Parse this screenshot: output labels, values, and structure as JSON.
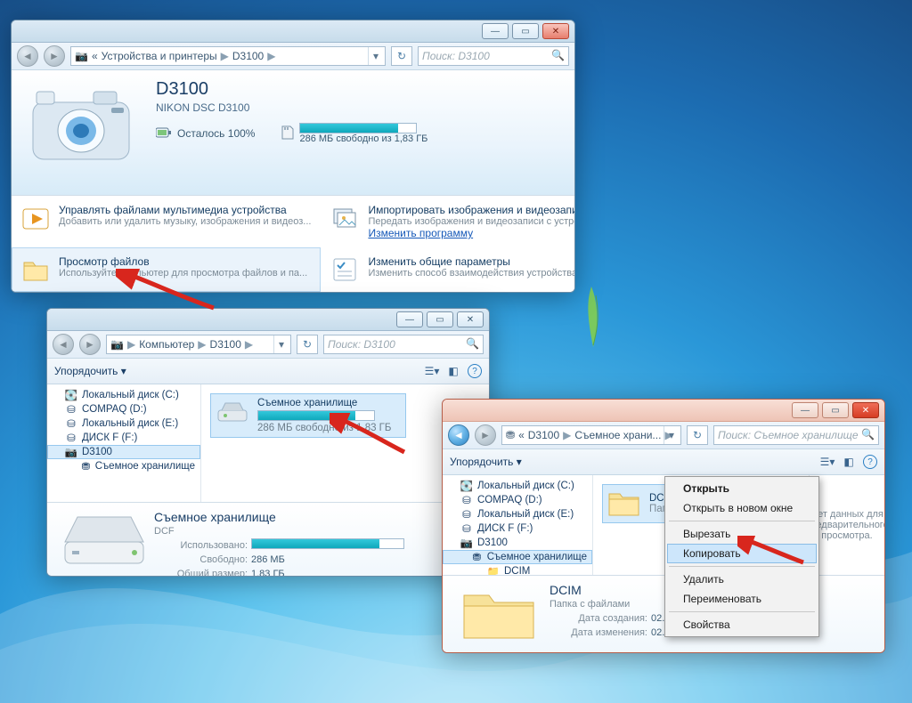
{
  "window1": {
    "breadcrumb_root": "Устройства и принтеры",
    "breadcrumb_item": "D3100",
    "search_placeholder": "Поиск: D3100",
    "device_title": "D3100",
    "device_subtitle": "NIKON DSC D3100",
    "battery_label": "Осталось 100%",
    "storage_label": "286 МБ свободно из 1,83 ГБ",
    "storage_fill_pct": 84,
    "tasks": {
      "manage": {
        "title": "Управлять файлами мультимедиа устройства",
        "desc": "Добавить или удалить музыку, изображения и видеоз..."
      },
      "import": {
        "title": "Импортировать изображения и видеозаписи",
        "desc": "Передать изображения и видеозаписи с устройства н...",
        "link": "Изменить программу"
      },
      "view": {
        "title": "Просмотр файлов",
        "desc": "Используйте компьютер для просмотра файлов и па..."
      },
      "settings": {
        "title": "Изменить общие параметры",
        "desc": "Изменить способ взаимодействия устройства с Wind..."
      }
    }
  },
  "window2": {
    "breadcrumb_root": "Компьютер",
    "breadcrumb_item": "D3100",
    "search_placeholder": "Поиск: D3100",
    "organize_label": "Упорядочить ▾",
    "tree": {
      "cdisk": "Локальный диск (C:)",
      "compaq": "COMPAQ (D:)",
      "edisk": "Локальный диск (E:)",
      "fdisk": "ДИСК F (F:)",
      "d3100": "D3100",
      "removable": "Съемное хранилище"
    },
    "drive": {
      "name": "Съемное хранилище",
      "free": "286 МБ свободно из 1,83 ГБ",
      "fill_pct": 84
    },
    "details": {
      "title": "Съемное хранилище",
      "type": "DCF",
      "used_label": "Использовано:",
      "used_fill_pct": 84,
      "free_label": "Свободно:",
      "free_value": "286 МБ",
      "total_label": "Общий размер:",
      "total_value": "1,83 ГБ"
    }
  },
  "window3": {
    "breadcrumb_root": "D3100",
    "breadcrumb_item": "Съемное храни...",
    "search_placeholder": "Поиск: Съемное хранилище",
    "organize_label": "Упорядочить ▾",
    "tree": {
      "cdisk": "Локальный диск (C:)",
      "compaq": "COMPAQ (D:)",
      "edisk": "Локальный диск (E:)",
      "fdisk": "ДИСК F (F:)",
      "d3100": "D3100",
      "removable": "Съемное хранилище",
      "dcim": "DCIM"
    },
    "folder": {
      "name": "DCIM",
      "type": "Папк..."
    },
    "preview_text": "Нет данных для предварительного просмотра.",
    "details": {
      "title": "DCIM",
      "type": "Папка с файлами",
      "created_label": "Дата создания:",
      "created_value": "02.07.2...",
      "mod_label": "Дата изменения:",
      "mod_value": "02.07.2014 18:25"
    }
  },
  "context_menu": {
    "open": "Открыть",
    "open_new": "Открыть в новом окне",
    "cut": "Вырезать",
    "copy": "Копировать",
    "delete": "Удалить",
    "rename": "Переименовать",
    "props": "Свойства"
  }
}
